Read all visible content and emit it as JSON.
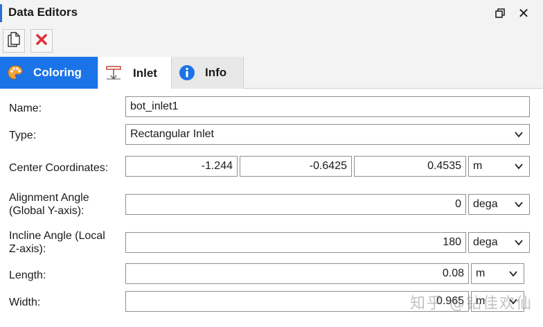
{
  "window": {
    "title": "Data Editors",
    "restore_icon": "restore-window-icon",
    "close_label": "✕"
  },
  "toolbar": {
    "new_icon": "new-document-icon",
    "delete_icon": "delete-x-icon",
    "delete_color": "#e0303a"
  },
  "tabs": [
    {
      "label": "Coloring",
      "icon": "palette-icon",
      "active": false,
      "color": "#1b73e8"
    },
    {
      "label": "Inlet",
      "icon": "inlet-icon",
      "active": true
    },
    {
      "label": "Info",
      "icon": "info-icon",
      "active": false
    }
  ],
  "form": {
    "name": {
      "label": "Name:",
      "value": "bot_inlet1"
    },
    "type": {
      "label": "Type:",
      "value": "Rectangular Inlet"
    },
    "center": {
      "label": "Center Coordinates:",
      "x": "-1.244",
      "y": "-0.6425",
      "z": "0.4535",
      "unit": "m"
    },
    "alignment": {
      "label_line1": "Alignment Angle",
      "label_line2": "(Global Y-axis):",
      "value": "0",
      "unit": "dega"
    },
    "incline": {
      "label_line1": "Incline Angle (Local",
      "label_line2": "Z-axis):",
      "value": "180",
      "unit": "dega"
    },
    "length": {
      "label": "Length:",
      "value": "0.08",
      "unit": "m"
    },
    "width": {
      "label": "Width:",
      "value": "0.965",
      "unit": "m"
    }
  },
  "watermark": "知乎 @钻佳欢仙"
}
